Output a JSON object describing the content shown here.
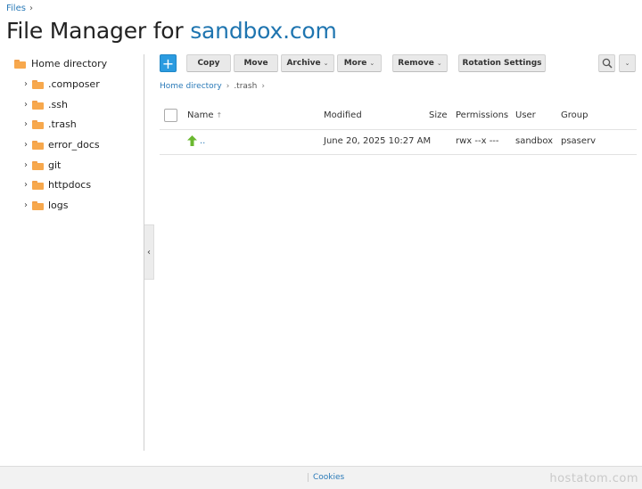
{
  "top_breadcrumb": {
    "label": "Files",
    "separator": "›"
  },
  "title": {
    "prefix": "File Manager for ",
    "domain": "sandbox.com"
  },
  "tree": {
    "root": {
      "label": "Home directory",
      "icon": "folder-icon"
    },
    "items": [
      {
        "label": ".composer",
        "icon": "folder-icon"
      },
      {
        "label": ".ssh",
        "icon": "folder-icon"
      },
      {
        "label": ".trash",
        "icon": "folder-icon"
      },
      {
        "label": "error_docs",
        "icon": "folder-icon"
      },
      {
        "label": "git",
        "icon": "folder-icon"
      },
      {
        "label": "httpdocs",
        "icon": "folder-icon"
      },
      {
        "label": "logs",
        "icon": "folder-icon"
      }
    ],
    "expand_glyph": "›"
  },
  "toolbar": {
    "add_glyph": "+",
    "copy": "Copy",
    "move": "Move",
    "archive": "Archive",
    "more": "More",
    "remove": "Remove",
    "rotation": "Rotation Settings",
    "caret": "⌄",
    "search_icon": "search-icon",
    "more2_glyph": "⌄"
  },
  "breadcrumb": {
    "home": "Home directory",
    "current": ".trash",
    "separator": "›"
  },
  "table": {
    "headers": {
      "name": "Name",
      "sort_glyph": "↑",
      "modified": "Modified",
      "size": "Size",
      "permissions": "Permissions",
      "user": "User",
      "group": "Group"
    },
    "rows": [
      {
        "name": "..",
        "icon": "up-arrow-icon",
        "modified": "June 20, 2025 10:27 AM",
        "size": "",
        "permissions": "rwx --x ---",
        "user": "sandbox",
        "group": "psaserv"
      }
    ]
  },
  "collapse_glyph": "‹",
  "footer": {
    "cookies": "Cookies",
    "watermark": "hostatom.com"
  },
  "colors": {
    "accent": "#2b9be0",
    "link": "#2a7ab8",
    "folder": "#f7a84d",
    "up_arrow": "#6ab82f"
  }
}
